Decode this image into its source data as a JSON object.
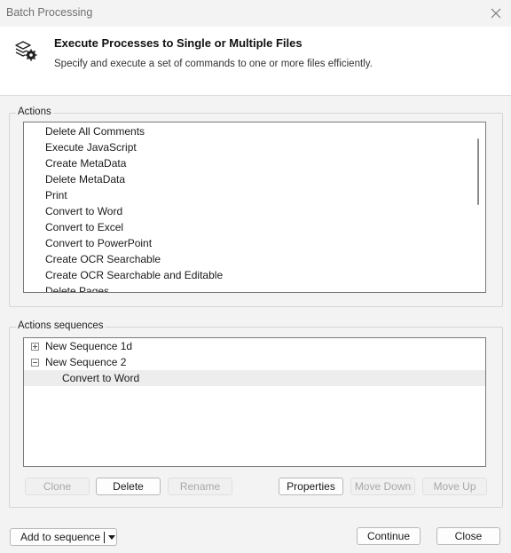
{
  "window": {
    "title": "Batch Processing"
  },
  "header": {
    "icon": "gear-layers-icon",
    "title": "Execute Processes to Single or Multiple Files",
    "subtitle": "Specify and execute a set of commands to one or more files efficiently."
  },
  "actions": {
    "label": "Actions",
    "items": [
      "Delete All Comments",
      "Execute JavaScript",
      "Create MetaData",
      "Delete MetaData",
      "Print",
      "Convert to Word",
      "Convert to Excel",
      "Convert to PowerPoint",
      "Create OCR Searchable",
      "Create OCR Searchable and Editable",
      "Delete Pages"
    ]
  },
  "sequences": {
    "label": "Actions sequences",
    "items": [
      {
        "label": "New Sequence 1d",
        "expanded": false
      },
      {
        "label": "New Sequence 2",
        "expanded": true,
        "children": [
          "Convert to Word"
        ]
      }
    ],
    "buttons": {
      "clone": "Clone",
      "delete": "Delete",
      "rename": "Rename",
      "properties": "Properties",
      "move_down": "Move Down",
      "move_up": "Move Up"
    }
  },
  "footer": {
    "add_to_sequence": "Add to sequence",
    "continue": "Continue",
    "close": "Close"
  }
}
